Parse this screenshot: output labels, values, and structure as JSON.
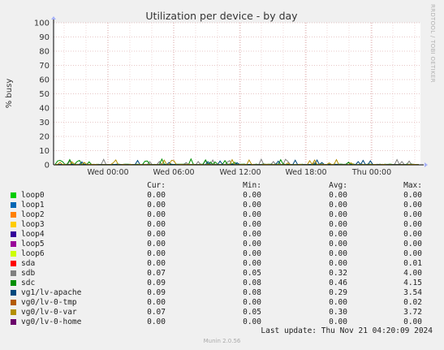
{
  "colors": {
    "background": "#f0f0f0",
    "plot_bg": "#ffffff",
    "grid_minor": "#e8c0c0",
    "grid_major": "#d09090",
    "axis": "#000000",
    "title": "#333333"
  },
  "chart_data": {
    "type": "line",
    "title": "Utilization per device - by day",
    "ylabel": "% busy",
    "xlabel": "",
    "ylim": [
      0,
      100
    ],
    "yticks": [
      0,
      10,
      20,
      30,
      40,
      50,
      60,
      70,
      80,
      90,
      100
    ],
    "xticks": [
      "Wed 00:00",
      "Wed 06:00",
      "Wed 12:00",
      "Wed 18:00",
      "Thu 00:00"
    ],
    "grid": true,
    "side_label": "RRDTOOL / TOBI OETIKER",
    "series": [
      {
        "name": "loop0",
        "color": "#00cc00",
        "cur": "0.00",
        "min": "0.00",
        "avg": "0.00",
        "max": "0.00"
      },
      {
        "name": "loop1",
        "color": "#0066b3",
        "cur": "0.00",
        "min": "0.00",
        "avg": "0.00",
        "max": "0.00"
      },
      {
        "name": "loop2",
        "color": "#ff8000",
        "cur": "0.00",
        "min": "0.00",
        "avg": "0.00",
        "max": "0.00"
      },
      {
        "name": "loop3",
        "color": "#ffcc00",
        "cur": "0.00",
        "min": "0.00",
        "avg": "0.00",
        "max": "0.00"
      },
      {
        "name": "loop4",
        "color": "#330099",
        "cur": "0.00",
        "min": "0.00",
        "avg": "0.00",
        "max": "0.00"
      },
      {
        "name": "loop5",
        "color": "#990099",
        "cur": "0.00",
        "min": "0.00",
        "avg": "0.00",
        "max": "0.00"
      },
      {
        "name": "loop6",
        "color": "#ccff00",
        "cur": "0.00",
        "min": "0.00",
        "avg": "0.00",
        "max": "0.00"
      },
      {
        "name": "sda",
        "color": "#ff0000",
        "cur": "0.00",
        "min": "0.00",
        "avg": "0.00",
        "max": "0.01"
      },
      {
        "name": "sdb",
        "color": "#808080",
        "cur": "0.07",
        "min": "0.05",
        "avg": "0.32",
        "max": "4.00"
      },
      {
        "name": "sdc",
        "color": "#008f00",
        "cur": "0.09",
        "min": "0.08",
        "avg": "0.46",
        "max": "4.15"
      },
      {
        "name": "vg1/lv-apache",
        "color": "#00487d",
        "cur": "0.09",
        "min": "0.08",
        "avg": "0.29",
        "max": "3.54"
      },
      {
        "name": "vg0/lv-0-tmp",
        "color": "#b35a00",
        "cur": "0.00",
        "min": "0.00",
        "avg": "0.00",
        "max": "0.02"
      },
      {
        "name": "vg0/lv-0-var",
        "color": "#b38f00",
        "cur": "0.07",
        "min": "0.05",
        "avg": "0.30",
        "max": "3.72"
      },
      {
        "name": "vg0/lv-0-home",
        "color": "#6b006b",
        "cur": "0.00",
        "min": "0.00",
        "avg": "0.00",
        "max": "0.00"
      }
    ]
  },
  "legend": {
    "headers": {
      "cur": "Cur:",
      "min": "Min:",
      "avg": "Avg:",
      "max": "Max:"
    },
    "last_update": "Last update: Thu Nov 21 04:20:09 2024"
  },
  "footer": "Munin 2.0.56"
}
